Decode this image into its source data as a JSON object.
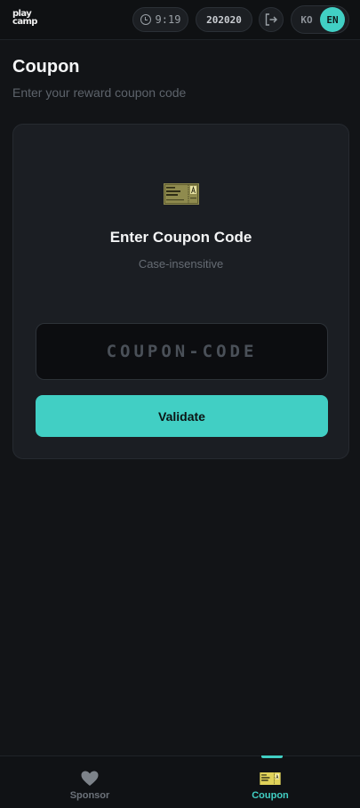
{
  "brand": {
    "logo_line1": "play",
    "logo_line2": "camp"
  },
  "topbar": {
    "time": "9:19",
    "code": "202020",
    "lang_ko": "KO",
    "lang_en": "EN"
  },
  "header": {
    "title": "Coupon",
    "subtitle": "Enter your reward coupon code"
  },
  "card": {
    "icon": "ticket-icon",
    "title": "Enter Coupon Code",
    "hint": "Case-insensitive",
    "input_placeholder": "COUPON-CODE",
    "input_value": "",
    "button_label": "Validate"
  },
  "nav": {
    "items": [
      {
        "label": "Sponsor",
        "icon": "heart-icon",
        "active": false
      },
      {
        "label": "Coupon",
        "icon": "ticket-icon",
        "active": true
      }
    ]
  },
  "colors": {
    "accent": "#41cfc4",
    "background": "#121417",
    "card": "#1b1e23"
  }
}
